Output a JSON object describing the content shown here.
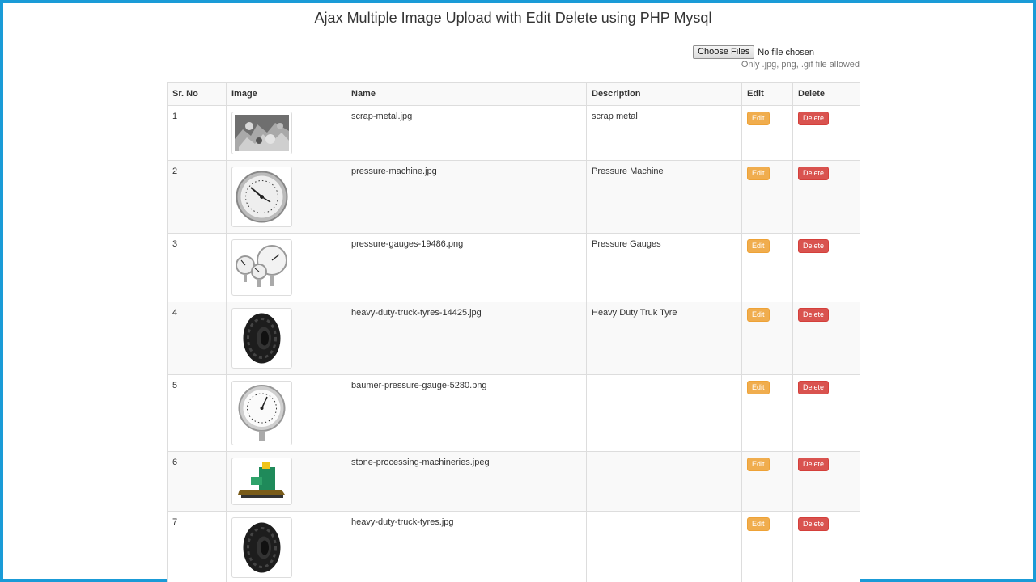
{
  "page": {
    "title": "Ajax Multiple Image Upload with Edit Delete using PHP Mysql"
  },
  "upload": {
    "button_label": "Choose Files",
    "status": "No file chosen",
    "hint": "Only .jpg, png, .gif file allowed"
  },
  "table": {
    "headers": [
      "Sr. No",
      "Image",
      "Name",
      "Description",
      "Edit",
      "Delete"
    ],
    "edit_label": "Edit",
    "delete_label": "Delete",
    "rows": [
      {
        "sr": "1",
        "image": "scrap-metal-image",
        "name": "scrap-metal.jpg",
        "description": "scrap metal"
      },
      {
        "sr": "2",
        "image": "pressure-machine-image",
        "name": "pressure-machine.jpg",
        "description": "Pressure Machine"
      },
      {
        "sr": "3",
        "image": "pressure-gauges-image",
        "name": "pressure-gauges-19486.png",
        "description": "Pressure Gauges"
      },
      {
        "sr": "4",
        "image": "truck-tyre-image",
        "name": "heavy-duty-truck-tyres-14425.jpg",
        "description": "Heavy Duty Truk Tyre"
      },
      {
        "sr": "5",
        "image": "baumer-gauge-image",
        "name": "baumer-pressure-gauge-5280.png",
        "description": ""
      },
      {
        "sr": "6",
        "image": "stone-machine-image",
        "name": "stone-processing-machineries.jpeg",
        "description": ""
      },
      {
        "sr": "7",
        "image": "truck-tyre-image",
        "name": "heavy-duty-truck-tyres.jpg",
        "description": ""
      }
    ]
  },
  "colors": {
    "frame": "#1a9bd7",
    "edit": "#f0ad4e",
    "delete": "#d9534f"
  }
}
